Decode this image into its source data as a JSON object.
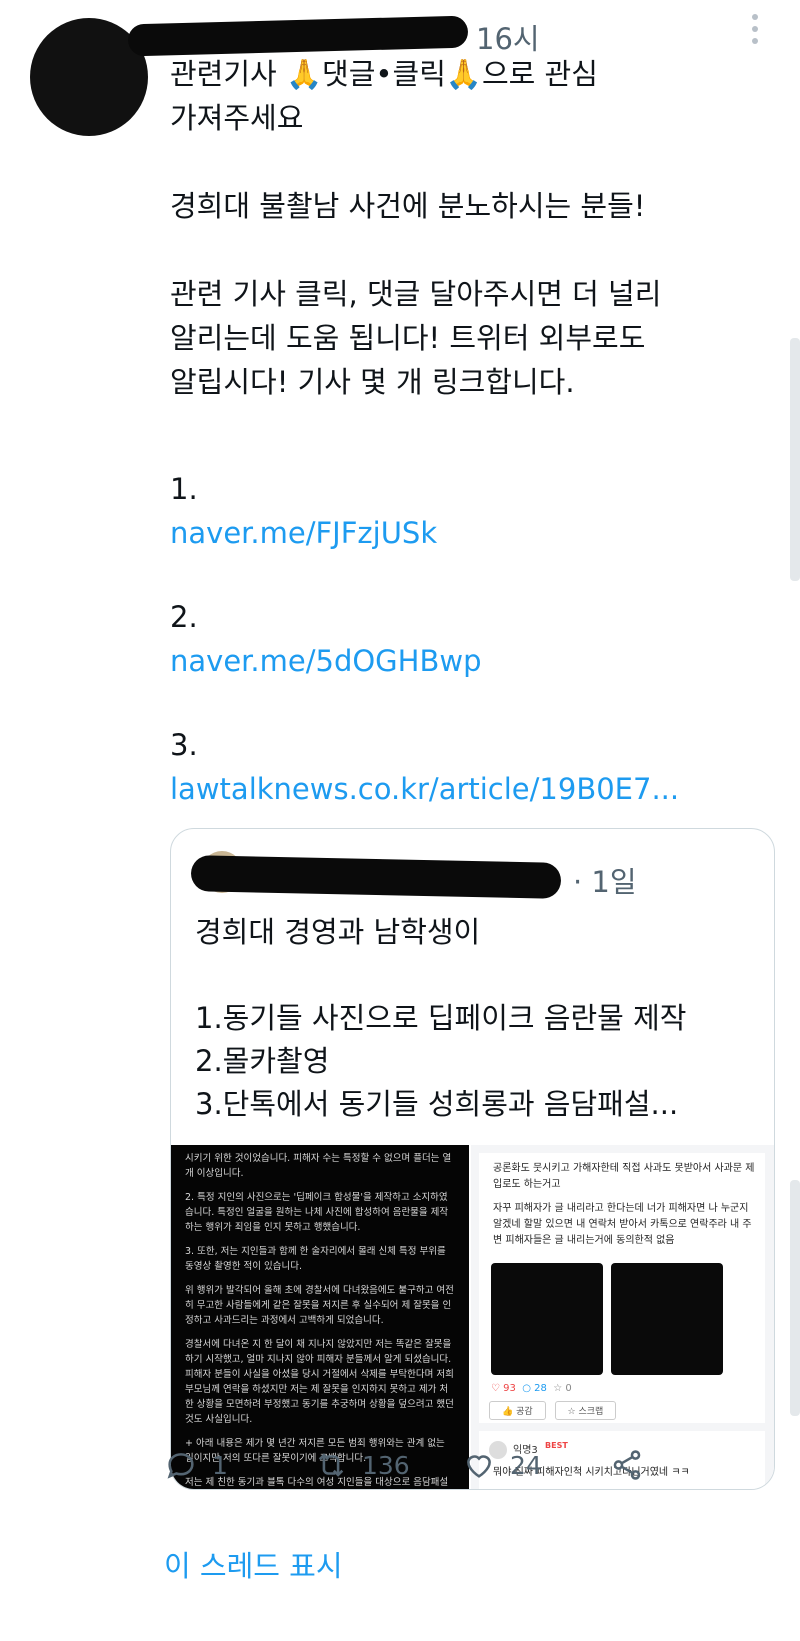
{
  "tweet": {
    "time": "16시",
    "paragraphs": [
      [
        "관련기사 🙏댓글•클릭🙏으로 관심",
        "가져주세요"
      ],
      [
        "경희대 불촬남 사건에 분노하시는 분들!"
      ],
      [
        "관련 기사 클릭, 댓글 달아주시면 더 널리",
        "알리는데 도움 됩니다! 트위터 외부로도",
        "알립시다! 기사 몇 개 링크합니다."
      ]
    ],
    "links": [
      {
        "num": "1.",
        "url": "naver.me/FJFzjUSk"
      },
      {
        "num": "2.",
        "url": "naver.me/5dOGHBwp"
      },
      {
        "num": "3.",
        "url": "lawtalknews.co.kr/article/19B0E7..."
      }
    ]
  },
  "quote": {
    "time": "· 1일",
    "lines": [
      "경희대 경영과 남학생이",
      "",
      "1.동기들 사진으로 딥페이크 음란물 제작",
      "2.몰카촬영",
      "3.단톡에서 동기들 성희롱과 음담패설..."
    ],
    "image_left_paragraphs": [
      "시키기 위한 것이었습니다. 피해자 수는 특정할 수 없으며 플더는 열 개 이상입니다.",
      "2. 특정 지인의 사진으로는 '딥페이크 합성물'을 제작하고 소지하였습니다. 특정인 얼굴을 원하는 나체 사진에 합성하여 음란물을 제작하는 행위가 죄임을 인지 못하고 행했습니다.",
      "3. 또한, 저는 지인들과 함께 한 술자리에서 몰래 신체 특정 부위를 동영상 촬영한 적이 있습니다.",
      "위 행위가 발각되어 올해 초에 경찰서에 다녀왔음에도 불구하고 여전히 무고한 사람들에게 같은 잘못을 저지른 후 실수되어 제 잘못을 인정하고 사과드리는 과정에서 고백하게 되었습니다.",
      "경찰서에 다녀온 지 한 달이 채 지나지 않았지만 저는 똑같은 잘못을 하기 시작했고, 얼마 지나지 않아 피해자 분들께서 알게 되셨습니다. 피해자 분들이 사실을 아셨을 당시 거절에서 삭제를 부탁한다며 저희 부모님께 연락을 하셨지만 저는 제 잘못을 인지하지 못하고 제가 처한 상황을 모면하려 부정했고 동기를 추궁하며 상황을 덮으려고 했던 것도 사실입니다.",
      "+ 아래 내용은 제가 몇 년간 저지른 모든 범죄 행위와는 관계 없는 일이지만 저의 또다른 잘못이기에 고백합니다.",
      "저는 제 친한 동기과 블톡 다수의 여성 지인들을 대상으로 음담패설을 즐기기도 했습니다. 제 범죄 행위가 발각되기 한참 전에 음담패설을 나눈 대화방이 일려졌고, 저는 지인과 동기에 대한 음담을..."
    ],
    "image_right": {
      "text": [
        "공론화도 뭇시키고 가해자한테 직접 사과도 못받아서 사과문 제입로도 하는거고",
        "자꾸 피해자가 글 내리라고 한다는데 너가 피해자면 나 누군지 알겠네 할말 있으면 내 연락처 받아서 카톡으로 연락주라 내 주변 피해자들은 글 내리는거에 동의한적 없음"
      ],
      "likes": "93",
      "comments": "28",
      "other": "0",
      "btn_like": "공감",
      "btn_scrap": "스크랩",
      "commenter": "익명3",
      "best": "BEST",
      "comment": "뭐야 진짜 피해자인척 시키치고다닌거였네 ㅋㅋ"
    }
  },
  "actions": {
    "reply_count": "1",
    "retweet_count": "136",
    "like_count": "24"
  },
  "show_thread": "이 스레드 표시",
  "colors": {
    "link": "#1d9bf0",
    "muted": "#536471",
    "border": "#cfd9de"
  }
}
